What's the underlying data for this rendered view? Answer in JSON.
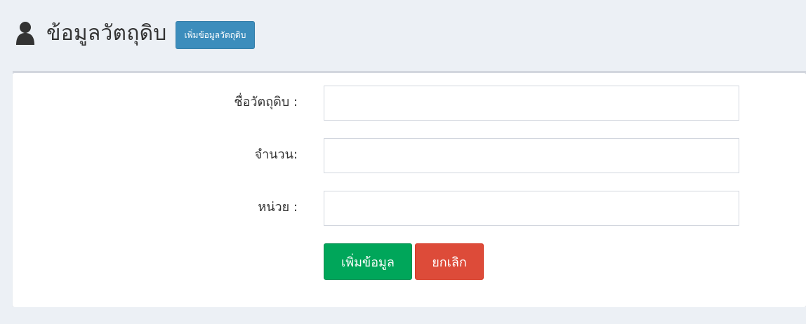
{
  "header": {
    "title": "ข้อมูลวัตถุดิบ",
    "add_button_label": "เพิ่มข้อมูลวัตถุดิบ",
    "icon": "user-icon"
  },
  "form": {
    "fields": [
      {
        "label": "ชื่อวัตถุดิบ :",
        "value": "",
        "placeholder": ""
      },
      {
        "label": "จำนวน:",
        "value": "",
        "placeholder": ""
      },
      {
        "label": "หน่วย :",
        "value": "",
        "placeholder": ""
      }
    ],
    "actions": {
      "save_label": "เพิ่มข้อมูล",
      "cancel_label": "ยกเลิก"
    }
  },
  "colors": {
    "page_background": "#ecf0f5",
    "panel_background": "#ffffff",
    "primary": "#3c8dbc",
    "success": "#00a65a",
    "danger": "#dd4b39",
    "text": "#333333"
  }
}
